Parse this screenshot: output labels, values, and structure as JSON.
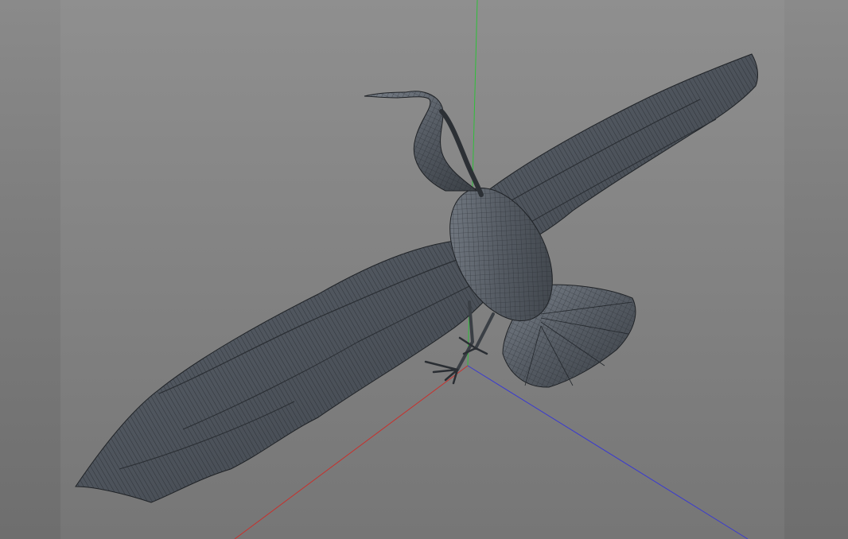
{
  "viewport": {
    "background_top": "#8f8f8f",
    "background_bottom": "#767676",
    "side_band_color": "#7c7c7c"
  },
  "axes": {
    "x_color": "#d02a2a",
    "y_color": "#2ad02a",
    "z_color": "#2a2ad0"
  },
  "model": {
    "icon": "heron-wireframe",
    "fill_color": "#4a5058",
    "wire_color": "#1f2226",
    "highlight_color": "#6a717a"
  }
}
